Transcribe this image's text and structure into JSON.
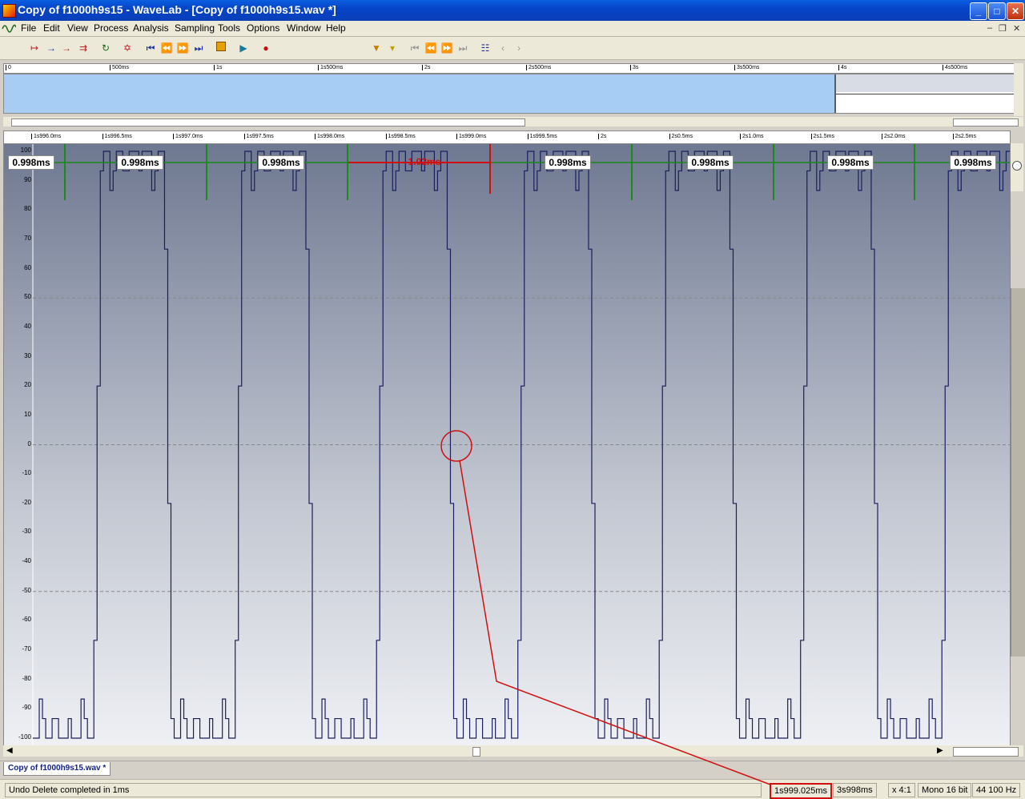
{
  "window": {
    "title": "Copy of f1000h9s15 - WaveLab - [Copy of f1000h9s15.wav *]",
    "min": "_",
    "max": "□",
    "close": "✕"
  },
  "menu": [
    "File",
    "Edit",
    "View",
    "Process",
    "Analysis",
    "Sampling",
    "Tools",
    "Options",
    "Window",
    "Help"
  ],
  "overview_ruler": [
    "0",
    "500ms",
    "1s",
    "1s500ms",
    "2s",
    "2s500ms",
    "3s",
    "3s500ms",
    "4s",
    "4s500ms"
  ],
  "main_ruler": [
    "1s996.0ms",
    "1s996.5ms",
    "1s997.0ms",
    "1s997.5ms",
    "1s998.0ms",
    "1s998.5ms",
    "1s999.0ms",
    "1s999.5ms",
    "2s",
    "2s0.5ms",
    "2s1.0ms",
    "2s1.5ms",
    "2s2.0ms",
    "2s2.5ms"
  ],
  "y_axis": [
    "100",
    "90",
    "80",
    "70",
    "60",
    "50",
    "40",
    "30",
    "20",
    "10",
    "0",
    "-10",
    "-20",
    "-30",
    "-40",
    "-50",
    "-60",
    "-70",
    "-80",
    "-90",
    "-100"
  ],
  "period_labels": [
    "0.998ms",
    "0.998ms",
    "0.998ms",
    "1.02ms",
    "0.998ms",
    "0.998ms",
    "0.998ms",
    "0.998ms"
  ],
  "highlight_label_index": 3,
  "colors": {
    "waveform": "#1a1f5c",
    "marker": "#1a8a1a",
    "highlight": "#d01010",
    "overview_fill": "#a8cdf4"
  },
  "tab": {
    "label": "Copy of f1000h9s15.wav *"
  },
  "status": {
    "message": "Undo Delete completed in 1ms",
    "cursor_time": "1s999.025ms",
    "length": "3s998ms",
    "zoom": "x 4:1",
    "format": "Mono 16 bit",
    "rate": "44 100 Hz"
  },
  "chart_data": {
    "type": "line",
    "xlabel": "",
    "ylabel": "",
    "ylim": [
      -100,
      100
    ],
    "period_ms": 1.0,
    "harmonics": 9,
    "quant_steps": 15,
    "periods_visible": 7,
    "grid": "dashed lines at 50, 0, -50"
  }
}
